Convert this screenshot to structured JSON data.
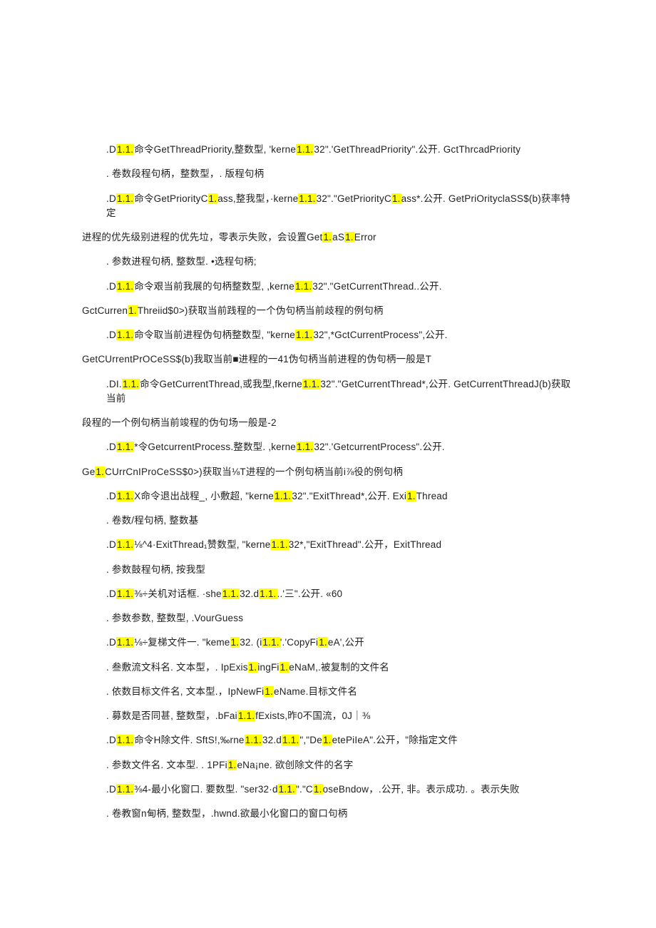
{
  "lines": [
    {
      "cls": "indent",
      "segs": [
        ".D",
        "H",
        "命令GetThreadPriority,整数型, 'kerne",
        "H",
        "32\".'GetThreadPriority\".公开. GctThrcadPriority"
      ]
    },
    {
      "cls": "indent",
      "segs": [
        ". 卷数段程句柄，整数型，. 版程句柄"
      ]
    },
    {
      "cls": "indent",
      "segs": [
        ".D",
        "H",
        "命令GetPriorityC",
        "H",
        "ass,整我型，·kerne",
        "H",
        "32\".\"GetPriorityC",
        "H",
        "ass*.公开. GetPriOrityclaSS$(b)获率特定"
      ]
    },
    {
      "cls": "noindent",
      "segs": [
        "进程的优先级别进程的优先垃，零表示失败，会设置Get",
        "H",
        "aS",
        "H",
        "Error"
      ]
    },
    {
      "cls": "indent",
      "segs": [
        ". 参数进程句柄, 整数型. •选程句柄;"
      ]
    },
    {
      "cls": "indent",
      "segs": [
        ".D",
        "H",
        "命令艰当前我展的句柄整数型, ,kerne",
        "H",
        "32\".\"GetCurrentThread..公开."
      ]
    },
    {
      "cls": "noindent",
      "segs": [
        "GctCurren",
        "H",
        "Threiid$0>)获取当前践程的一个伪句柄当前歧程的例句柄"
      ]
    },
    {
      "cls": "indent",
      "segs": [
        ".D",
        "H",
        "命令取当前进程伪句柄整数型, \"kerne",
        "H",
        "32\",*GctCurrentProcess\",公开."
      ]
    },
    {
      "cls": "noindent",
      "segs": [
        "GetCUrrentPrOCeSS$(b)我取当前■进程的一41伪句柄当前进程的伪句柄一般是T"
      ]
    },
    {
      "cls": "indent",
      "segs": [
        ".DI.",
        "H",
        "命令GetCurrentThread,或我型,fkerne",
        "H",
        "32\".\"GetCurrentThread*,公开. GetCurrentThreadJ(b)获取当前"
      ]
    },
    {
      "cls": "noindent",
      "segs": [
        "段程的一个例句柄当前竣程的伪句场一般是-2"
      ]
    },
    {
      "cls": "indent",
      "segs": [
        ".D",
        "H",
        "*令GetcurrentProcess.整数型. ,kerne",
        "H",
        "32\".'GetcurrentProcess\".公开."
      ]
    },
    {
      "cls": "noindent",
      "segs": [
        "Ge",
        "H",
        "CUrrCnIProCeSS$0>)获取当⅛T进程的一个例句柄当前i⅞役的例句柄"
      ]
    },
    {
      "cls": "indent",
      "segs": [
        ".D",
        "H",
        "X命令退出战程_, 小敷超, \"kerne",
        "H",
        "32\".\"ExitThread*,公开. Exi",
        "H",
        "Thread"
      ]
    },
    {
      "cls": "indent",
      "segs": [
        ". 卷数/程句柄, 整数基"
      ]
    },
    {
      "cls": "indent",
      "segs": [
        ".D",
        "H",
        "⅛^4·ExitThread₁赞数型, \"kerne",
        "H",
        "32*,\"ExitThread\".公开，ExitThread"
      ]
    },
    {
      "cls": "indent",
      "segs": [
        ". 参数鼓程句柄, 按我型"
      ]
    },
    {
      "cls": "indent",
      "segs": [
        ".D",
        "H",
        "⅜÷关机对话框. ·she",
        "H",
        "32.d",
        "H",
        "..'三\".公开. «60"
      ]
    },
    {
      "cls": "indent",
      "segs": [
        ". 参数参数, 整数型, .VourGuess"
      ]
    },
    {
      "cls": "indent",
      "segs": [
        ".D",
        "H",
        "⅛÷复梯文件一. \"keme",
        "H",
        "32. (i",
        "H",
        "'.'CopyFi",
        "H",
        "eA',公开"
      ]
    },
    {
      "cls": "indent",
      "segs": [
        ". 叁敷流文科名. 文本型，. IpExis",
        "H",
        "ingFi",
        "H",
        "eNaM,.被复制的文件名"
      ]
    },
    {
      "cls": "indent",
      "segs": [
        ". 依数目标文件名, 文本型.，IpNewFi",
        "H",
        "eName.目标文件名"
      ]
    },
    {
      "cls": "indent",
      "segs": [
        ". 募数是否同甚, 整数型，.bFai",
        "H",
        "fExists,昨0不国流，0J｜⅜"
      ]
    },
    {
      "cls": "indent",
      "segs": [
        ".D",
        "H",
        "命令H除文件. SftS!,‰rne",
        "H",
        "32.d",
        "H",
        "\",\"De",
        "H",
        "etePiIeA\".公开，\"除指定文件"
      ]
    },
    {
      "cls": "indent",
      "segs": [
        ". 参数文件名. 文本型. . 1PFi",
        "H",
        "eNa¡ne. 欲创除文件的名字"
      ]
    },
    {
      "cls": "indent",
      "segs": [
        ".D",
        "H",
        "⅜4-最小化窗口. 要数型. \"ser32·d",
        "H",
        "\".\"C",
        "H",
        "oseBndow，.公开, 非。表示成功. 。表示失败"
      ]
    },
    {
      "cls": "indent",
      "segs": [
        ". 卷教窗n甸柄, 整数型，.hwnd.欲最小化窗口的窗口句柄"
      ]
    }
  ],
  "highlight_token": "1.1.",
  "highlight_single": "1."
}
